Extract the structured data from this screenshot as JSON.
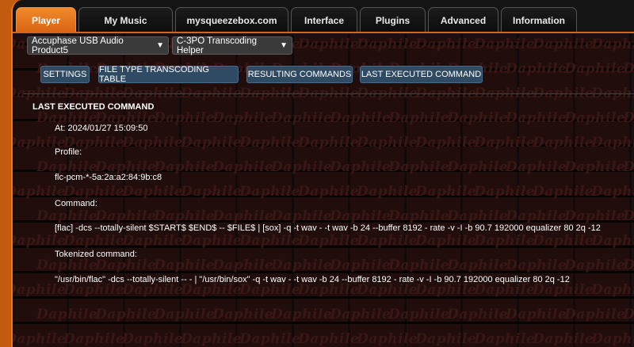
{
  "tabs": [
    {
      "label": "Player",
      "active": true
    },
    {
      "label": "My Music",
      "active": false
    },
    {
      "label": "mysqueezebox.com",
      "active": false
    },
    {
      "label": "Interface",
      "active": false
    },
    {
      "label": "Plugins",
      "active": false
    },
    {
      "label": "Advanced",
      "active": false
    },
    {
      "label": "Information",
      "active": false
    }
  ],
  "selectors": {
    "player": "Accuphase USB Audio Product5",
    "plugin": "C-3PO Transcoding Helper"
  },
  "subtabs": [
    "SETTINGS",
    "FILE TYPE TRANSCODING TABLE",
    "RESULTING COMMANDS",
    "LAST EXECUTED COMMAND"
  ],
  "section": {
    "heading": "LAST EXECUTED COMMAND",
    "at": "At: 2024/01/27 15:09:50",
    "profile_label": "Profile:",
    "profile_value": "flc-pcm-*-5a:2a:a2:84:9b:c8",
    "command_label": "Command:",
    "command_value": "[flac] -dcs --totally-silent $START$ $END$ -- $FILE$ | [sox] -q -t wav - -t wav -b 24 --buffer 8192 - rate -v -I -b 90.7 192000 equalizer 80 2q -12",
    "tokenized_label": "Tokenized command:",
    "tokenized_value": "\"/usr/bin/flac\" -dcs --totally-silent -- - | \"/usr/bin/sox\" -q -t wav - -t wav -b 24 --buffer 8192 - rate -v -I -b 90.7 192000 equalizer 80 2q -12"
  },
  "background_word": "Daphile",
  "colors": {
    "accent": "#e07020",
    "button_blue": "#2f4a63",
    "background": "#141414"
  }
}
